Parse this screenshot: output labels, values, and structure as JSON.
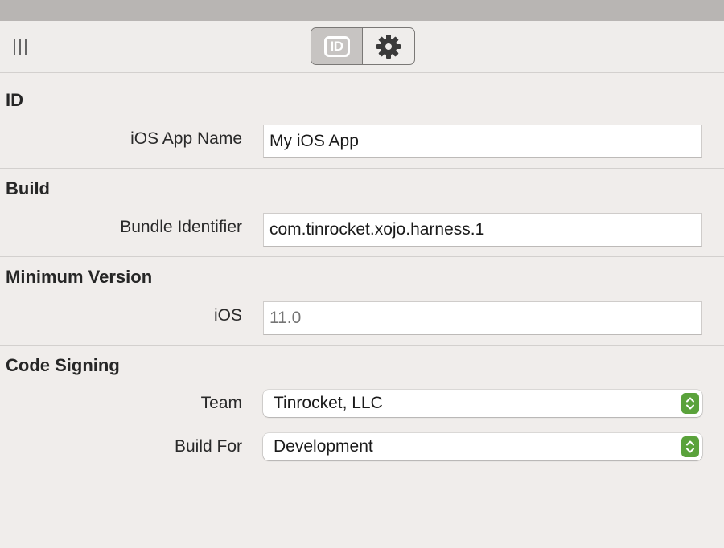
{
  "toolbar": {
    "id_tab_label": "ID",
    "icons": [
      "sidebar-toggle-icon",
      "id-badge-icon",
      "gear-icon"
    ]
  },
  "sections": {
    "id": {
      "title": "ID",
      "app_name_label": "iOS App Name",
      "app_name_value": "My iOS App"
    },
    "build": {
      "title": "Build",
      "bundle_label": "Bundle Identifier",
      "bundle_value": "com.tinrocket.xojo.harness.1"
    },
    "min_version": {
      "title": "Minimum Version",
      "ios_label": "iOS",
      "ios_value": "",
      "ios_placeholder": "11.0"
    },
    "code_signing": {
      "title": "Code Signing",
      "team_label": "Team",
      "team_value": "Tinrocket, LLC",
      "build_for_label": "Build For",
      "build_for_value": "Development"
    }
  },
  "colors": {
    "background": "#f0edeb",
    "title_bar": "#b8b5b3",
    "popup_accent": "#5aa23b"
  }
}
